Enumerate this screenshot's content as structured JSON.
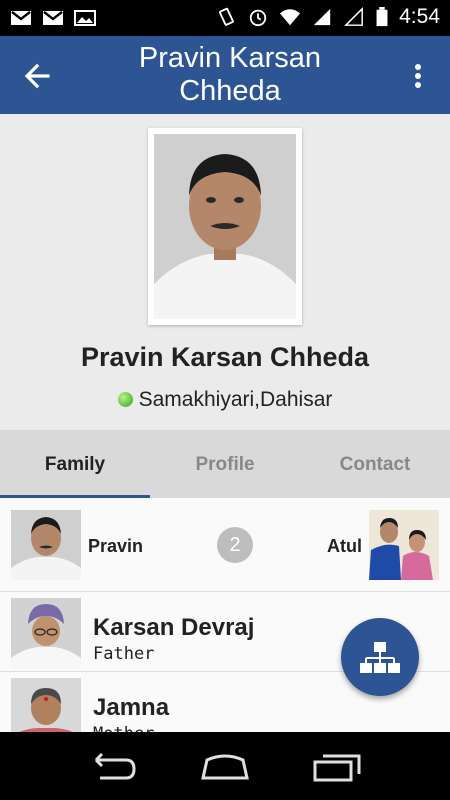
{
  "status_bar": {
    "time": "4:54",
    "left_icons": [
      "gmail-icon",
      "gmail-icon",
      "gallery-icon"
    ],
    "right_icons": [
      "vibrate-icon",
      "alarm-icon",
      "wifi-icon",
      "signal-icon",
      "signal-icon",
      "battery-icon"
    ]
  },
  "app_bar": {
    "title": "Pravin Karsan Chheda",
    "back_icon": "arrow-left-icon",
    "menu_icon": "more-vert-icon",
    "color": "#2e5593"
  },
  "profile": {
    "name": "Pravin Karsan Chheda",
    "location": "Samakhiyari,Dahisar",
    "status_color": "#3cb52a"
  },
  "tabs": [
    {
      "label": "Family",
      "active": true
    },
    {
      "label": "Profile",
      "active": false
    },
    {
      "label": "Contact",
      "active": false
    }
  ],
  "siblings": {
    "left_name": "Pravin",
    "count": "2",
    "right_name": "Atul"
  },
  "members": [
    {
      "name": "Karsan Devraj",
      "relation": "Father"
    },
    {
      "name": "Jamna",
      "relation": "Mother"
    }
  ],
  "fab": {
    "icon": "family-tree-icon"
  },
  "nav": {
    "icons": [
      "back-nav-icon",
      "home-nav-icon",
      "recents-nav-icon"
    ]
  }
}
